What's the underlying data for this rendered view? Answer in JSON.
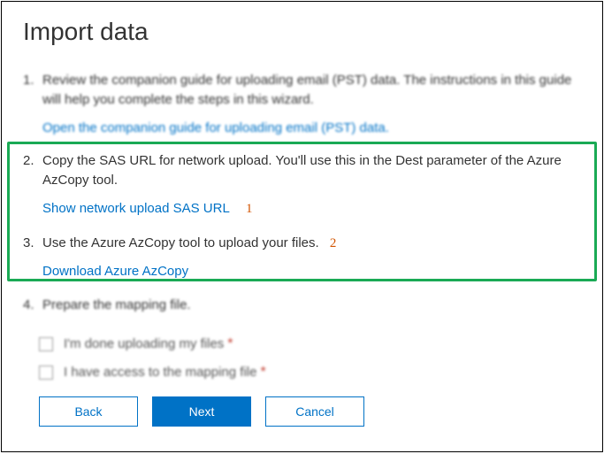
{
  "title": "Import data",
  "steps": {
    "s1": {
      "text": "Review the companion guide for uploading email (PST) data. The instructions in this guide will help you complete the steps in this wizard.",
      "link": "Open the companion guide for uploading email (PST) data."
    },
    "s2": {
      "text": "Copy the SAS URL for network upload. You'll use this in the Dest parameter of the Azure AzCopy tool.",
      "link": "Show network upload SAS URL",
      "annot": "1"
    },
    "s3": {
      "text": "Use the Azure AzCopy tool to upload your files.",
      "annot": "2",
      "link": "Download Azure AzCopy"
    },
    "s4": {
      "text": "Prepare the mapping file."
    }
  },
  "checkboxes": {
    "c1": {
      "label": "I'm done uploading my files",
      "required": "*"
    },
    "c2": {
      "label": "I have access to the mapping file",
      "required": "*"
    }
  },
  "buttons": {
    "back": "Back",
    "next": "Next",
    "cancel": "Cancel"
  }
}
